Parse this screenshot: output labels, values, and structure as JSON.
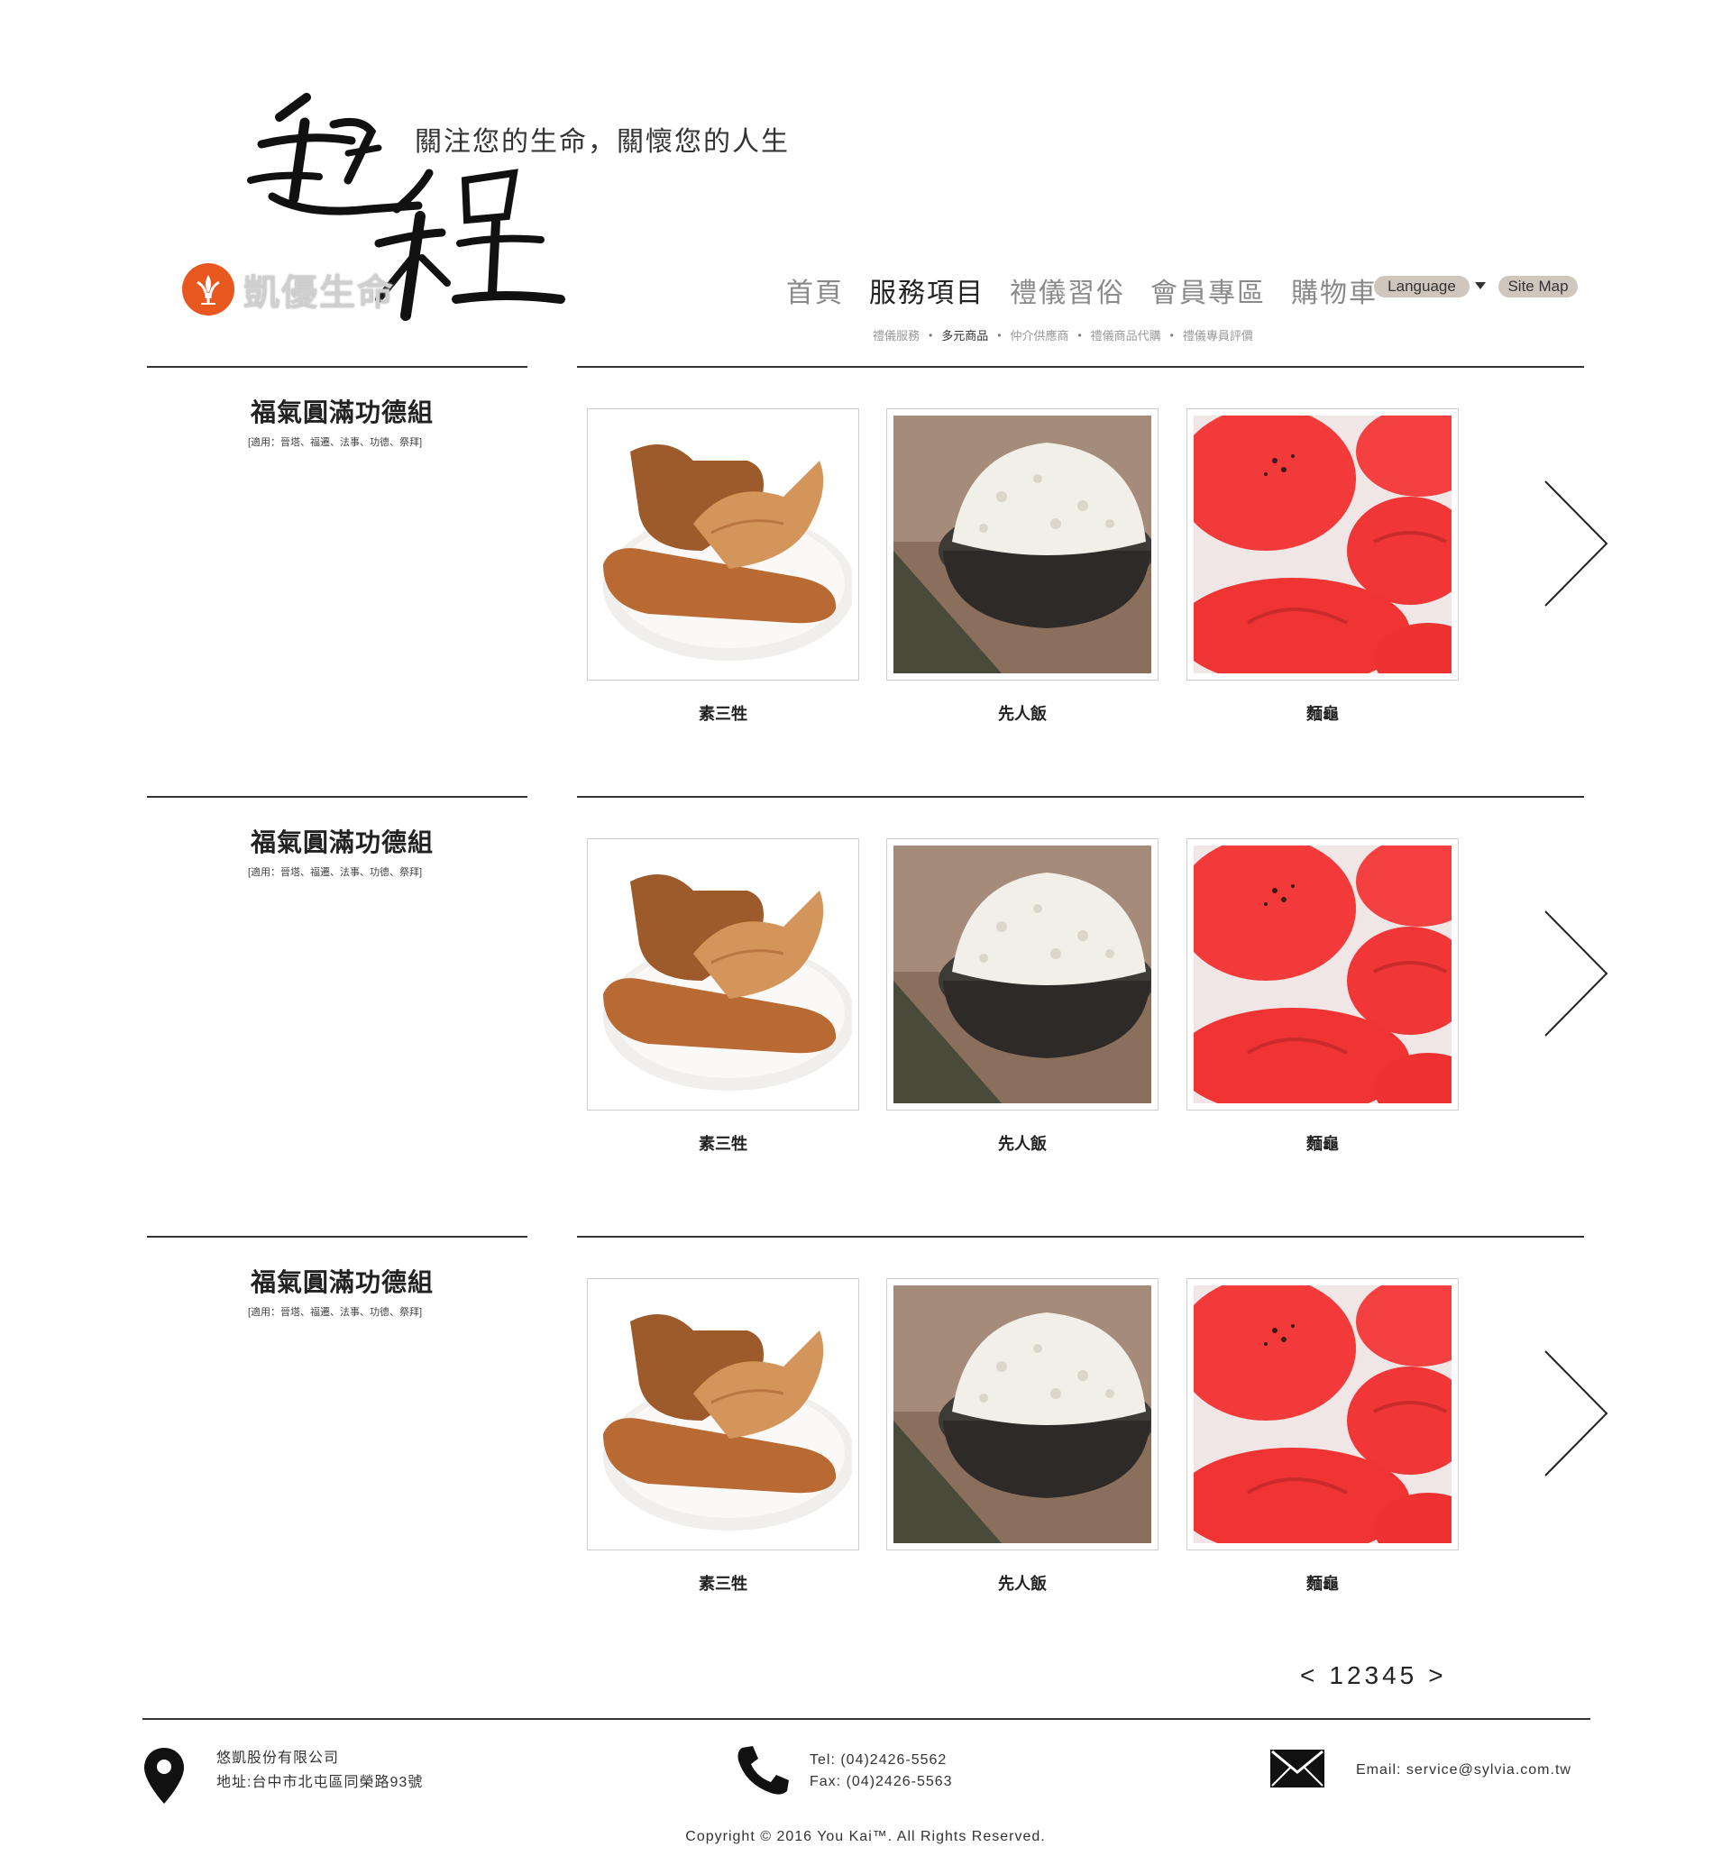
{
  "header": {
    "logo_calligraphy": "起程",
    "slogan": "關注您的生命，關懷您的人生",
    "brand_name": "凱優生命"
  },
  "nav": {
    "items": [
      {
        "label": "首頁",
        "active": false
      },
      {
        "label": "服務項目",
        "active": true
      },
      {
        "label": "禮儀習俗",
        "active": false
      },
      {
        "label": "會員專區",
        "active": false
      },
      {
        "label": "購物車",
        "active": false
      }
    ],
    "language_label": "Language",
    "sitemap_label": "Site Map"
  },
  "subnav": {
    "items": [
      {
        "label": "禮儀服務",
        "active": false
      },
      {
        "label": "多元商品",
        "active": true
      },
      {
        "label": "仲介供應商",
        "active": false
      },
      {
        "label": "禮儀商品代購",
        "active": false
      },
      {
        "label": "禮儀專員評價",
        "active": false
      }
    ],
    "separator": "•"
  },
  "sets": [
    {
      "title": "福氣圓滿功德組",
      "note": "[適用：晉塔、福遷、法事、功德、祭拜]",
      "products": [
        {
          "label": "素三牲",
          "image": "vegetarian-offerings"
        },
        {
          "label": "先人飯",
          "image": "rice-bowl"
        },
        {
          "label": "麵龜",
          "image": "red-turtle-buns"
        }
      ]
    },
    {
      "title": "福氣圓滿功德組",
      "note": "[適用：晉塔、福遷、法事、功德、祭拜]",
      "products": [
        {
          "label": "素三牲",
          "image": "vegetarian-offerings"
        },
        {
          "label": "先人飯",
          "image": "rice-bowl"
        },
        {
          "label": "麵龜",
          "image": "red-turtle-buns"
        }
      ]
    },
    {
      "title": "福氣圓滿功德組",
      "note": "[適用：晉塔、福遷、法事、功德、祭拜]",
      "products": [
        {
          "label": "素三牲",
          "image": "vegetarian-offerings"
        },
        {
          "label": "先人飯",
          "image": "rice-bowl"
        },
        {
          "label": "麵龜",
          "image": "red-turtle-buns"
        }
      ]
    }
  ],
  "pagination": {
    "prev": "<",
    "pages": [
      "1",
      "2",
      "3",
      "4",
      "5"
    ],
    "next": ">"
  },
  "footer": {
    "company": "悠凱股份有限公司",
    "address": "地址:台中市北屯區同榮路93號",
    "tel": "Tel: (04)2426-5562",
    "fax": "Fax: (04)2426-5563",
    "email": "Email: service@sylvia.com.tw",
    "copyright": "Copyright © 2016 You Kai™. All Rights Reserved."
  },
  "colors": {
    "brand_orange": "#e8571e",
    "pill_bg": "#cfc6bd",
    "nav_inactive": "#8a8a8a",
    "rule": "#333333"
  }
}
